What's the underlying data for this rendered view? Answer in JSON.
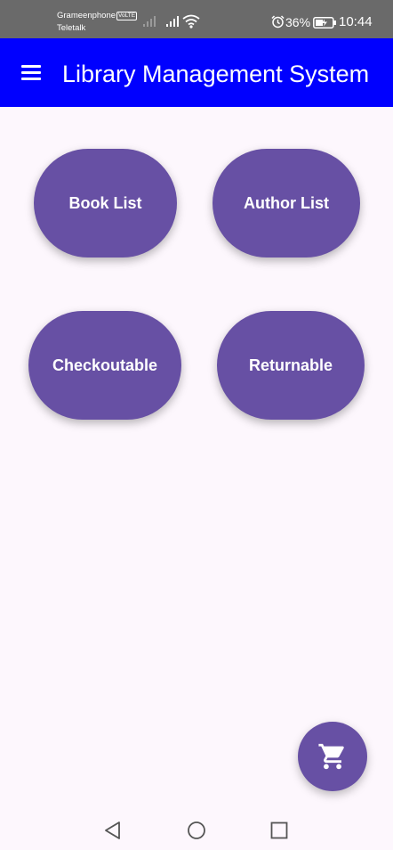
{
  "status_bar": {
    "carrier_1": "Grameenphone",
    "volte_badge": "VoLTE",
    "carrier_2": "Teletalk",
    "battery_percent": "36%",
    "time": "10:44"
  },
  "app_bar": {
    "title": "Library Management System",
    "menu_icon": "menu-icon"
  },
  "buttons": {
    "book_list": "Book List",
    "author_list": "Author List",
    "checkoutable": "Checkoutable",
    "returnable": "Returnable"
  },
  "fab": {
    "icon": "cart-icon"
  },
  "nav": {
    "back_icon": "back-icon",
    "home_icon": "home-icon",
    "recent_icon": "recent-apps-icon"
  },
  "colors": {
    "app_bar": "#0000ff",
    "button": "#6750a4",
    "background": "#fdf7fd",
    "status_bar": "#6a6a6a"
  }
}
